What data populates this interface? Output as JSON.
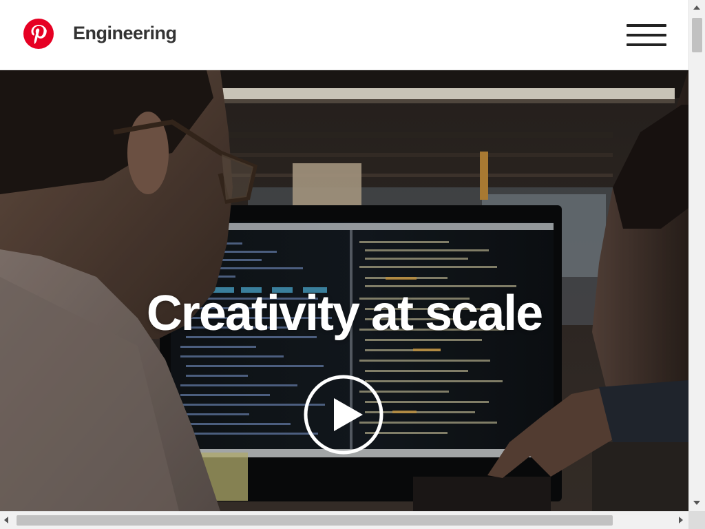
{
  "header": {
    "brand": "Engineering",
    "logo_icon": "pinterest-logo-icon",
    "menu_icon": "hamburger-menu-icon",
    "brand_color": "#e60023"
  },
  "hero": {
    "headline": "Creativity at scale",
    "play_icon": "play-icon"
  },
  "scrollbars": {
    "vertical": "vertical-scrollbar",
    "horizontal": "horizontal-scrollbar"
  }
}
